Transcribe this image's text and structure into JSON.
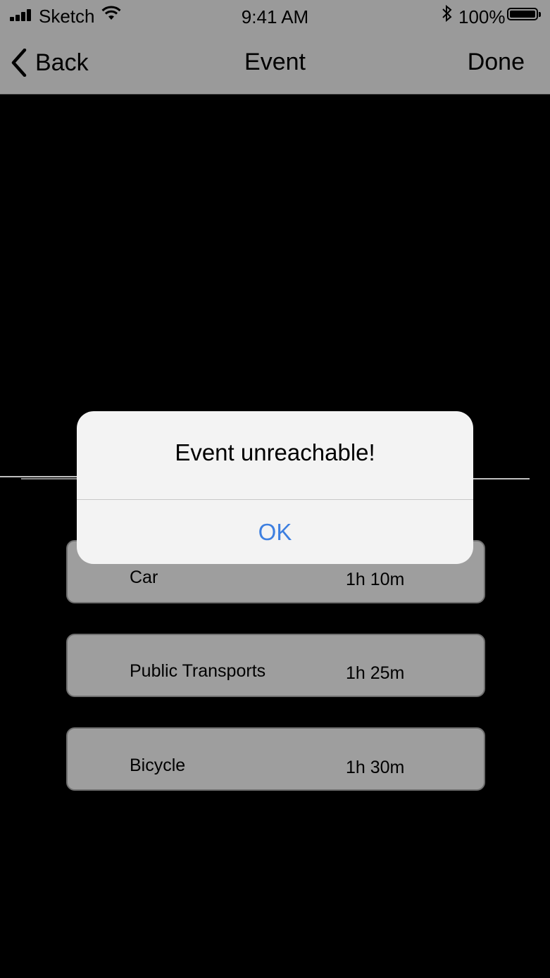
{
  "status_bar": {
    "carrier": "Sketch",
    "time": "9:41 AM",
    "battery_percent": "100%",
    "icons": [
      "signal-icon",
      "wifi-icon",
      "bluetooth-icon",
      "battery-icon"
    ]
  },
  "nav": {
    "back_label": "Back",
    "title": "Event",
    "done_label": "Done"
  },
  "travel_options": [
    {
      "name": "Car",
      "duration": "1h 10m"
    },
    {
      "name": "Public Transports",
      "duration": "1h 25m"
    },
    {
      "name": "Bicycle",
      "duration": "1h 30m"
    }
  ],
  "alert": {
    "title": "Event unreachable!",
    "button_label": "OK"
  },
  "colors": {
    "alert_button": "#3d7fe0",
    "alert_background": "#f3f3f3",
    "overlay": "#000000"
  }
}
